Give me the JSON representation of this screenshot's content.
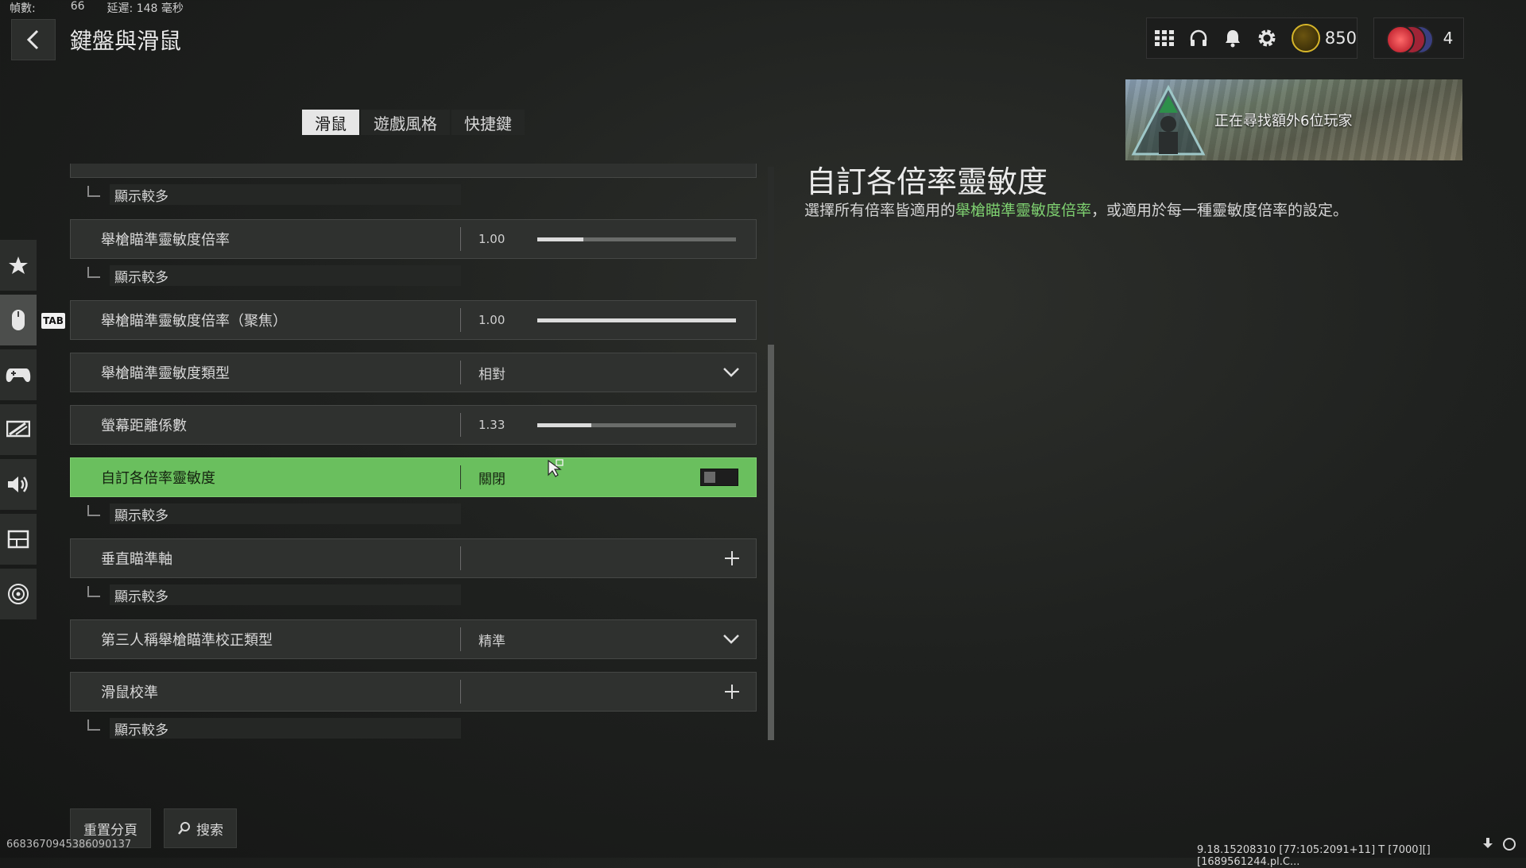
{
  "stats": {
    "fps_label": "幀數:",
    "fps_value": "66",
    "latency_text": "延遲: 148 毫秒"
  },
  "header": {
    "title": "鍵盤與滑鼠"
  },
  "topbar": {
    "currency_value": "850",
    "party_count": "4"
  },
  "banner": {
    "text": "正在尋找額外6位玩家"
  },
  "tabs": [
    {
      "label": "滑鼠",
      "active": true
    },
    {
      "label": "遊戲風格",
      "active": false
    },
    {
      "label": "快捷鍵",
      "active": false
    }
  ],
  "sidebar_tab_badge": "TAB",
  "settings": {
    "show_more": "顯示較多",
    "row1": {
      "label": "舉槍瞄準靈敏度倍率",
      "value": "1.00",
      "fill": 0.23
    },
    "row2": {
      "label": "舉槍瞄準靈敏度倍率（聚焦）",
      "value": "1.00",
      "fill": 1.0
    },
    "row3": {
      "label": "舉槍瞄準靈敏度類型",
      "value": "相對"
    },
    "row4": {
      "label": "螢幕距離係數",
      "value": "1.33",
      "fill": 0.27
    },
    "row5": {
      "label": "自訂各倍率靈敏度",
      "value": "關閉",
      "toggle_on": false
    },
    "row6": {
      "label": "垂直瞄準軸"
    },
    "row7": {
      "label": "第三人稱舉槍瞄準校正類型",
      "value": "精準"
    },
    "row8": {
      "label": "滑鼠校準"
    }
  },
  "detail": {
    "title": "自訂各倍率靈敏度",
    "desc_prefix": "選擇所有倍率皆適用的",
    "desc_link": "舉槍瞄準靈敏度倍率",
    "desc_suffix": "，或適用於每一種靈敏度倍率的設定。"
  },
  "footer": {
    "reset_label": "重置分頁",
    "search_label": "搜索",
    "uid": "6683670945386090137",
    "build_info": "9.18.15208310 [77:105:2091+11] T [7000][][1689561244.pl.C..."
  },
  "colors": {
    "highlight": "#6abf5e",
    "link": "#7ed070",
    "coin_ring": "#d6b52a"
  }
}
